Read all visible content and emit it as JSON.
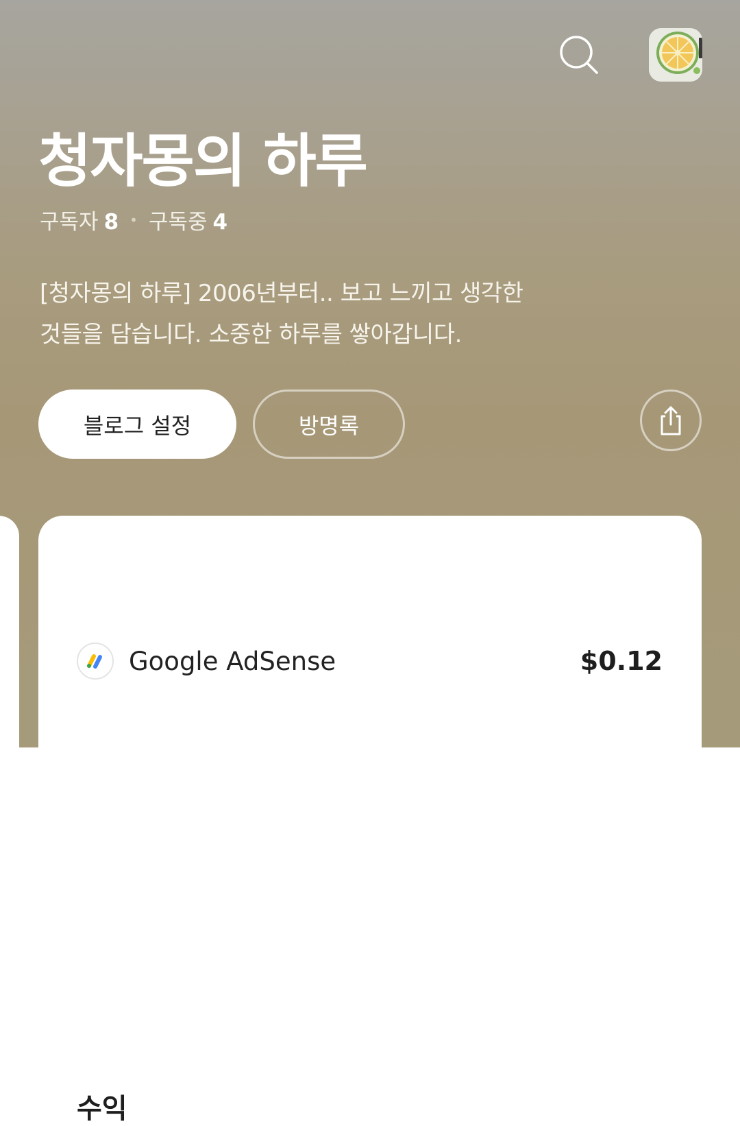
{
  "blog": {
    "title": "청자몽의 하루",
    "subscribers_label": "구독자",
    "subscribers_count": "8",
    "subscribing_label": "구독중",
    "subscribing_count": "4",
    "description_line1": "[청자몽의 하루] 2006년부터.. 보고 느끼고 생각한",
    "description_line2": "것들을 담습니다. 소중한 하루를 쌓아갑니다."
  },
  "buttons": {
    "settings": "블로그 설정",
    "guestbook": "방명록"
  },
  "revenue_card": {
    "title": "수익",
    "source": "Google AdSense",
    "amount": "$0.12"
  },
  "icons": {
    "search": "search-icon",
    "avatar": "profile-avatar",
    "share": "share-icon",
    "adsense": "adsense-logo"
  },
  "colors": {
    "hero_background": "#a69877",
    "text_light": "#ffffff"
  }
}
